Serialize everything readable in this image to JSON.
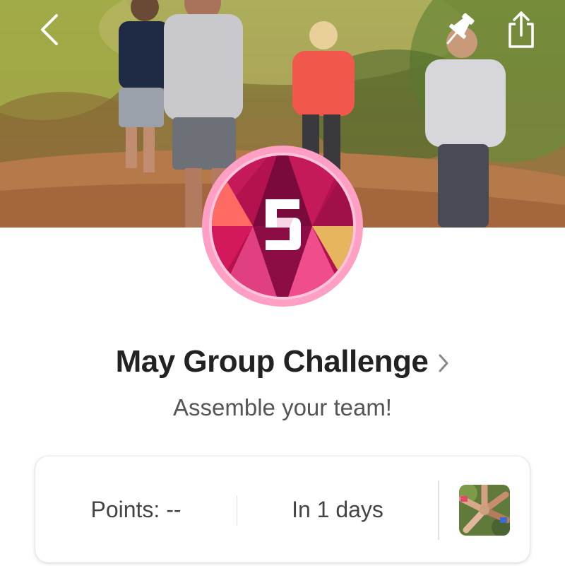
{
  "header": {
    "back_icon": "chevron-left-icon",
    "pin_icon": "pushpin-icon",
    "share_icon": "share-icon"
  },
  "hero": {
    "image": "people-jogging-on-autumn-forest-trail"
  },
  "badge": {
    "glyph": "5",
    "colors": [
      "#7a0a3b",
      "#b3124e",
      "#e0407f",
      "#ff6a63",
      "#e7b55e",
      "#ff9fc3"
    ]
  },
  "challenge": {
    "title": "May Group Challenge",
    "subtitle": "Assemble your team!"
  },
  "card": {
    "points_text": "Points: --",
    "days_text": "In 1 days",
    "team_image": "team-hands-in-circle"
  }
}
